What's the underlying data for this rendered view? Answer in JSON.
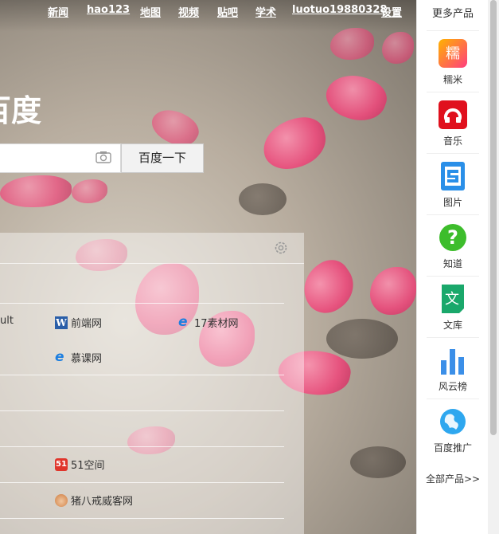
{
  "nav": [
    "新闻",
    "hao123",
    "地图",
    "视频",
    "贴吧",
    "学术",
    "luotuo19880328",
    "设置"
  ],
  "logo_text": "百度",
  "search": {
    "button_label": "百度一下",
    "value": ""
  },
  "panel": {
    "partial_label": "ult",
    "links": [
      "前端网",
      "17素材网",
      "慕课网",
      "51空间",
      "猪八戒威客网"
    ]
  },
  "sidebar": {
    "title": "更多产品",
    "items": [
      {
        "label": "糯米",
        "icon": "nuomi-icon"
      },
      {
        "label": "音乐",
        "icon": "music-icon"
      },
      {
        "label": "图片",
        "icon": "image-icon"
      },
      {
        "label": "知道",
        "icon": "zhidao-icon"
      },
      {
        "label": "文库",
        "icon": "wenku-icon"
      },
      {
        "label": "风云榜",
        "icon": "ranking-icon"
      },
      {
        "label": "百度推广",
        "icon": "tuiguang-icon"
      }
    ],
    "all_products": "全部产品>>"
  }
}
